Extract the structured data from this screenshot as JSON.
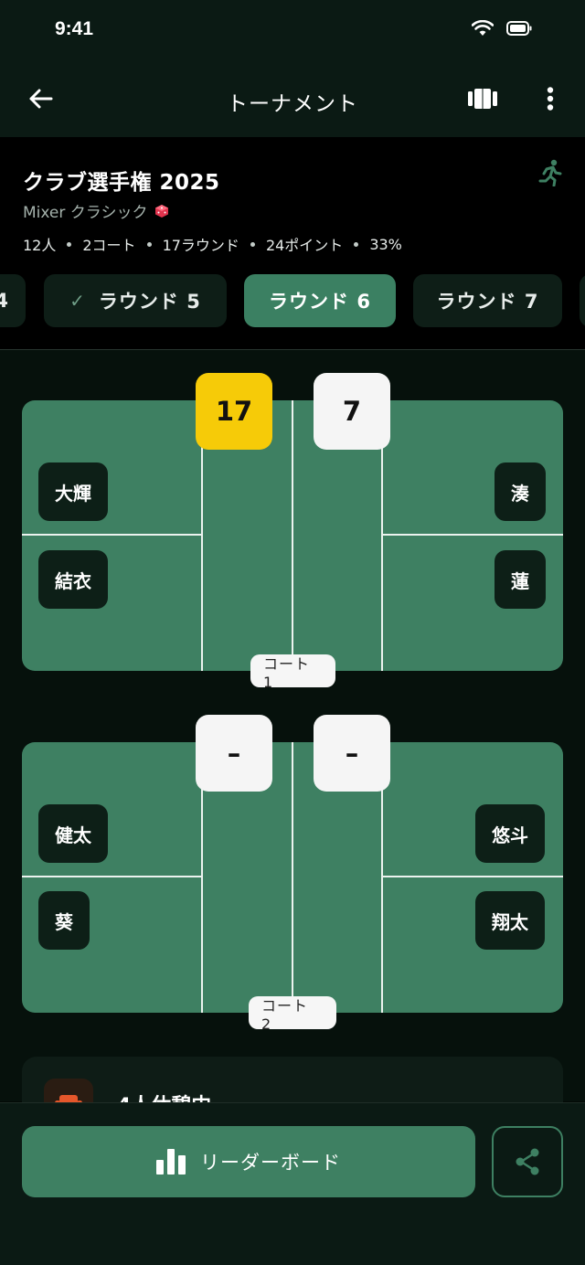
{
  "status_bar": {
    "time": "9:41"
  },
  "app_bar": {
    "title": "トーナメント"
  },
  "tournament": {
    "name": "クラブ選手権 2025",
    "mode": "Mixer クラシック",
    "meta": [
      "12人",
      "2コート",
      "17ラウンド",
      "24ポイント",
      "33%"
    ]
  },
  "rounds": {
    "prev_partial": "4",
    "items": [
      {
        "label": "ラウンド 5",
        "state": "completed"
      },
      {
        "label": "ラウンド 6",
        "state": "active"
      },
      {
        "label": "ラウンド 7",
        "state": "upcoming"
      }
    ]
  },
  "courts": [
    {
      "label": "コート 1",
      "team_left": [
        "大輝",
        "結衣"
      ],
      "team_right": [
        "湊",
        "蓮"
      ],
      "score_left": "17",
      "score_right": "7"
    },
    {
      "label": "コート 2",
      "team_left": [
        "健太",
        "葵"
      ],
      "team_right": [
        "悠斗",
        "翔太"
      ],
      "score_left": "–",
      "score_right": "–"
    }
  ],
  "resting": {
    "label": "4人休憩中"
  },
  "footer": {
    "leaderboard_label": "リーダーボード"
  },
  "colors": {
    "accent": "#3e8062",
    "winning_score": "#f6cb08",
    "background": "#030806"
  }
}
